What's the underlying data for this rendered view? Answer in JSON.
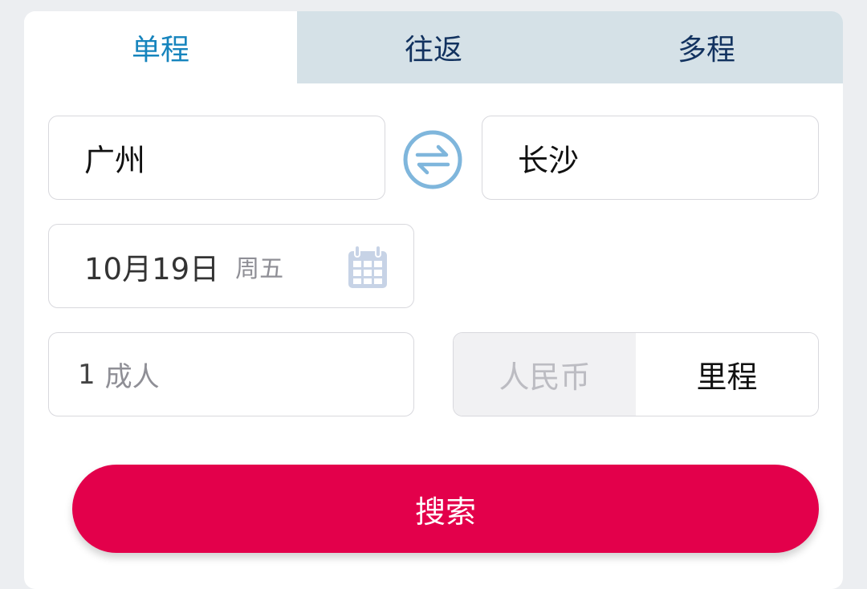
{
  "tabs": [
    {
      "label": "单程",
      "active": true
    },
    {
      "label": "往返",
      "active": false
    },
    {
      "label": "多程",
      "active": false
    }
  ],
  "route": {
    "origin": "广州",
    "destination": "长沙",
    "swap_icon": "swap-arrows-icon"
  },
  "date": {
    "value": "10月19日",
    "weekday": "周五",
    "icon": "calendar-icon"
  },
  "passengers": {
    "count": "1",
    "type": "成人"
  },
  "currency": {
    "options": [
      "人民币",
      "里程"
    ],
    "selected": "里程"
  },
  "search_label": "搜索",
  "colors": {
    "accent": "#e3004b",
    "tab_active_text": "#1684bd",
    "tab_inactive_bg": "#d5e1e7",
    "tab_text": "#12325f",
    "icon_blue": "#7fb6dc"
  }
}
